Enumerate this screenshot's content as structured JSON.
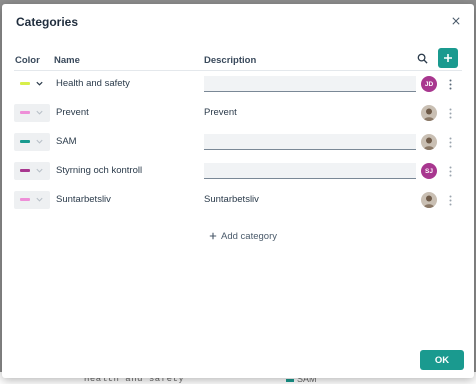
{
  "background": {
    "left_text": "Health and safety",
    "right_text": "SAM"
  },
  "dialog": {
    "title": "Categories",
    "close_icon": "close-icon",
    "columns": {
      "color": "Color",
      "name": "Name",
      "description": "Description"
    },
    "search_icon": "search-icon",
    "add_icon": "plus-icon",
    "rows": [
      {
        "name": "Health and safety",
        "color": "#d8ef4a",
        "description": "",
        "editable_description": true,
        "avatar_initials": "JD",
        "avatar_type": "initials",
        "active": true
      },
      {
        "name": "Prevent",
        "color": "#ee8fd8",
        "description": "Prevent",
        "editable_description": false,
        "avatar_type": "photo",
        "active": false
      },
      {
        "name": "SAM",
        "color": "#1a9a8f",
        "description": "",
        "editable_description": true,
        "avatar_type": "photo",
        "active": false
      },
      {
        "name": "Styrning och kontroll",
        "color": "#a8378f",
        "description": "",
        "editable_description": true,
        "avatar_initials": "SJ",
        "avatar_type": "initials",
        "active": false
      },
      {
        "name": "Suntarbetsliv",
        "color": "#ee8fd8",
        "description": "Suntarbetsliv",
        "editable_description": false,
        "avatar_type": "photo",
        "active": false
      }
    ],
    "add_category_label": "Add category",
    "ok_label": "OK"
  },
  "colors": {
    "accent": "#1a9a8f",
    "title": "#1f2d3d"
  }
}
